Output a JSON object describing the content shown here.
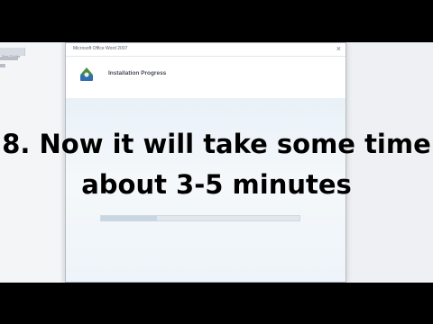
{
  "background_panel": {
    "header_label": "New Folder",
    "line1": "",
    "line2": ""
  },
  "installer_window": {
    "title": "Microsoft Office Word 2007",
    "close_glyph": "×",
    "heading": "Installation Progress",
    "progress_fraction": 0.28
  },
  "overlay": {
    "line1": "8. Now it will take some time",
    "line2": "about 3-5 minutes"
  },
  "colors": {
    "letterbox": "#000000",
    "window_bg": "#f7f8fa",
    "content_gradient_top": "#e9f1f8",
    "caption_text": "#000000"
  }
}
